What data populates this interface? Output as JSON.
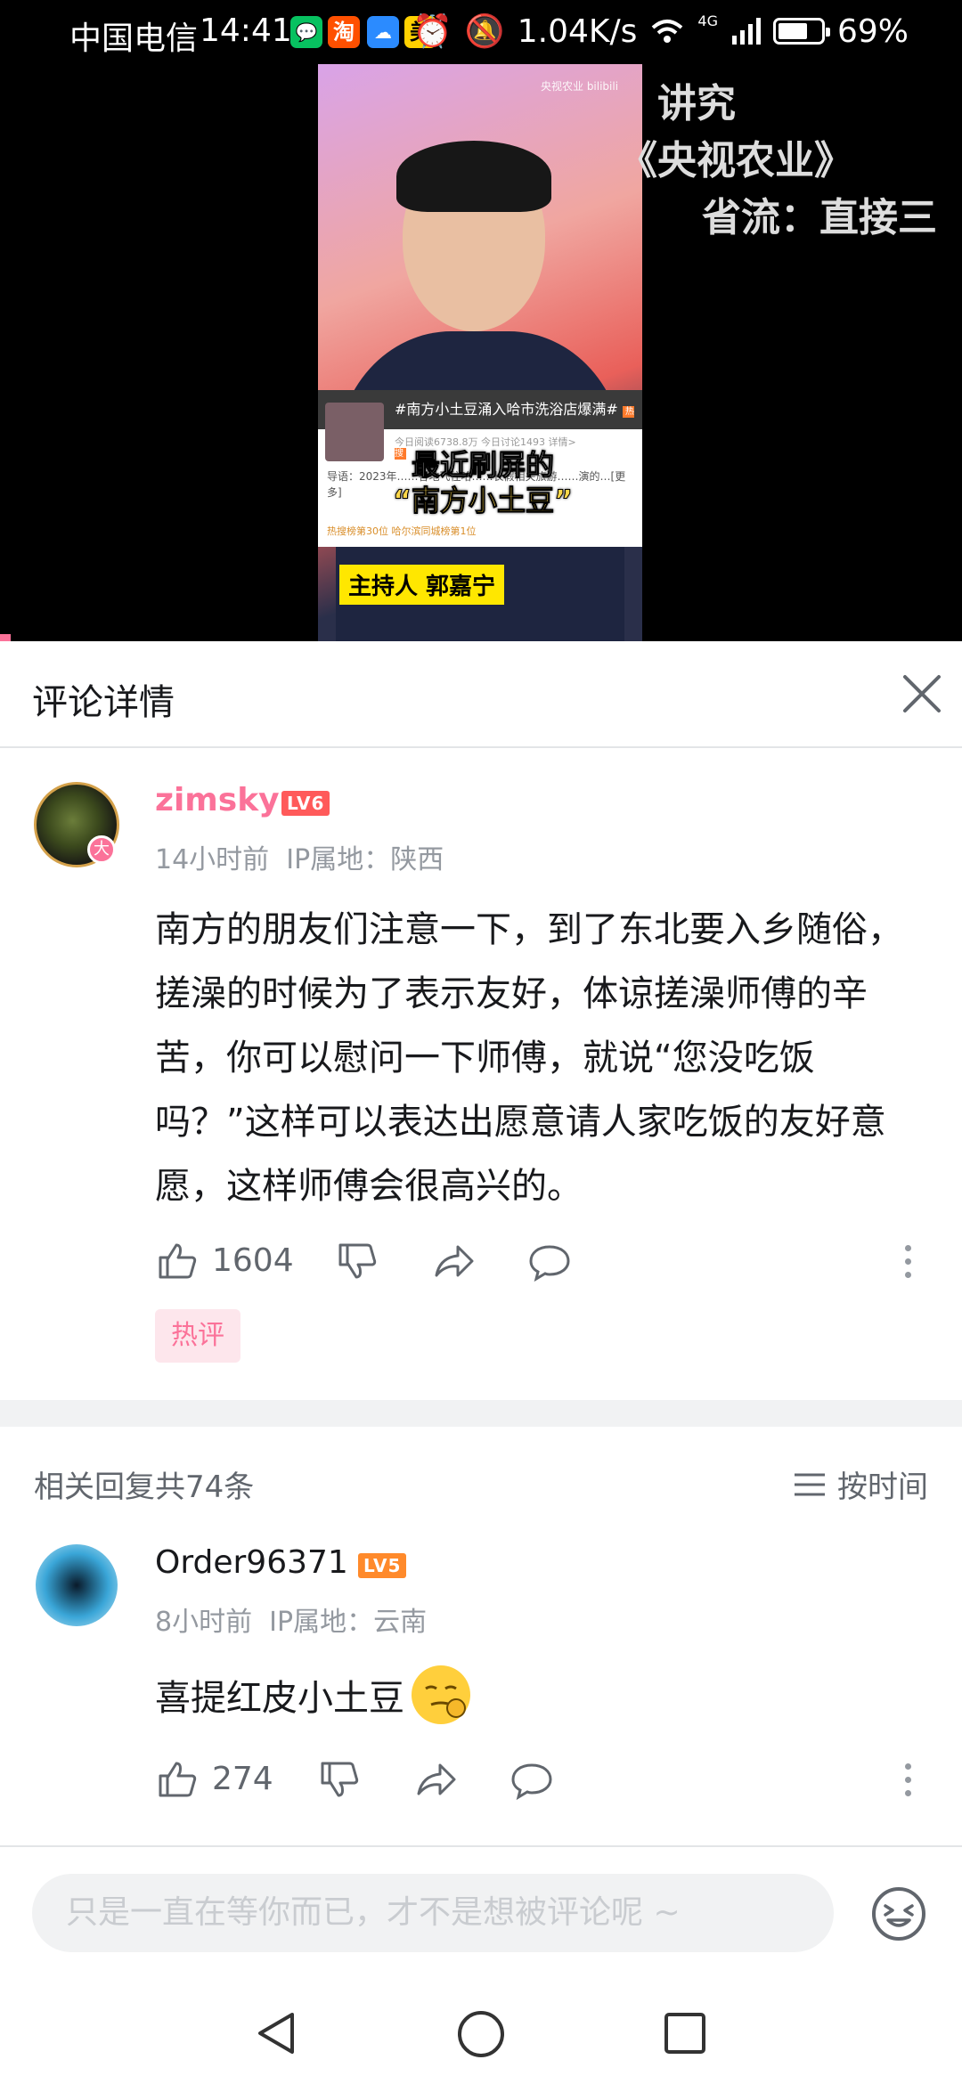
{
  "status_bar": {
    "carrier": "中国电信",
    "time": "14:41",
    "apps": [
      "淘",
      "美"
    ],
    "net_speed": "1.04K/s",
    "network": "4G",
    "battery": "69%",
    "battery_level": 0.69
  },
  "video": {
    "logo": "央视农业 bilibili",
    "danmaku": [
      "讲究",
      "《央视农业》",
      "省流：直接三"
    ],
    "news_card": {
      "headline": "#南方小土豆涌入哈市洗浴店爆满#",
      "hot_badge": "热搜",
      "meta": "今日阅读6738.8万  今日讨论1493  详情>",
      "body": "导语：2023年……各地飞往哈……长假相关旅游……演的…[更多]",
      "tags": "热搜榜第30位  哈尔滨同城榜第1位"
    },
    "caption_line1": "最近刷屏的",
    "caption_line2": "“南方小土豆”",
    "host_label": "主持人 郭嘉宁"
  },
  "detail": {
    "title": "评论详情"
  },
  "main_comment": {
    "username": "zimsky",
    "level": "LV6",
    "avatar_badge": "大",
    "time": "14小时前",
    "ip": "IP属地：陕西",
    "text": "南方的朋友们注意一下，到了东北要入乡随俗，搓澡的时候为了表示友好，体谅搓澡师傅的辛苦，你可以慰问一下师傅，就说“您没吃饭吗？”这样可以表达出愿意请人家吃饭的友好意愿，这样师傅会很高兴的。",
    "likes": "1604",
    "tag": "热评"
  },
  "replies_header": {
    "count_label": "相关回复共74条",
    "sort_label": "按时间"
  },
  "replies": [
    {
      "username": "Order96371",
      "level": "LV5",
      "time": "8小时前",
      "ip": "IP属地：云南",
      "text": "喜提红皮小土豆",
      "likes": "274"
    }
  ],
  "input": {
    "placeholder": "只是一直在等你而已，才不是想被评论呢 ~"
  },
  "colors": {
    "accent": "#fb7299",
    "text": "#18191c",
    "muted": "#9499a0",
    "lv6": "#ff5a5a",
    "lv5": "#ff8a2b"
  }
}
